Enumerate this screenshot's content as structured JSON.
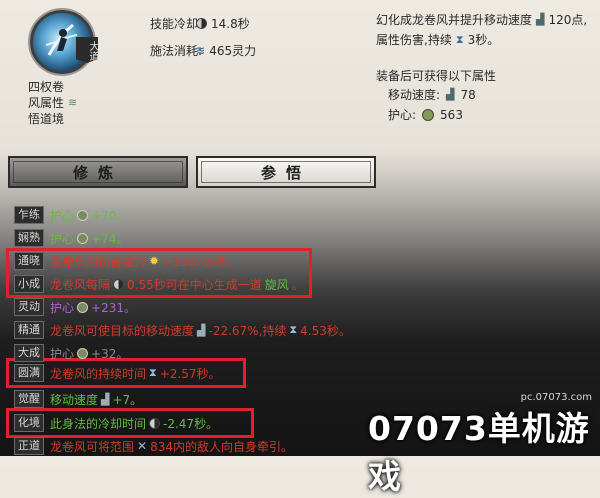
{
  "skill": {
    "badge": "大道",
    "meta": [
      "四权卷",
      "风属性",
      "悟道境"
    ],
    "cooldown_label": "技能冷却:",
    "cooldown_value": "14.8秒",
    "cost_label": "施法消耗:",
    "cost_value": "465灵力",
    "desc_line1": "幻化成龙卷风并提升移动速度",
    "desc_line1_value": "120点,",
    "desc_line2": "属性伤害,持续",
    "desc_line2_value": "3秒。",
    "equip_title": "装备后可获得以下属性",
    "equip_speed_label": "移动速度:",
    "equip_speed_value": "78",
    "equip_guard_label": "护心:",
    "equip_guard_value": "563"
  },
  "tabs": [
    {
      "label": "修炼",
      "active": false
    },
    {
      "label": "参悟",
      "active": true
    }
  ],
  "list": [
    {
      "tag": "乍练",
      "color": "#5fbf3c",
      "parts": [
        "护心",
        "+70。"
      ]
    },
    {
      "tag": "娴熟",
      "color": "#5fbf3c",
      "parts": [
        "护心",
        "+74。"
      ]
    },
    {
      "tag": "通晓",
      "color": "#d23a2a",
      "parts": [
        "龙卷风的伤害威力",
        "+15072/秒。"
      ]
    },
    {
      "tag": "小成",
      "color": "#d23a2a",
      "parts": [
        "龙卷风每隔",
        "0.55秒可在中心生成一道",
        "旋风",
        "。"
      ]
    },
    {
      "tag": "灵动",
      "color": "#b35fd6",
      "parts": [
        "护心",
        "+231。"
      ]
    },
    {
      "tag": "精通",
      "color": "#d23a2a",
      "parts": [
        "龙卷风可使目标的移动速度",
        "-22.67%,持续",
        "4.53秒。"
      ]
    },
    {
      "tag": "大成",
      "color": "#8a8a8a",
      "parts": [
        "护心",
        "+32。"
      ]
    },
    {
      "tag": "圆满",
      "color": "#d23a2a",
      "parts": [
        "龙卷风的持续时间",
        "+2.57秒。"
      ]
    },
    {
      "tag": "觉醒",
      "color": "#5fbf3c",
      "parts": [
        "移动速度",
        "+7。"
      ]
    },
    {
      "tag": "化境",
      "color": "#5fbf3c",
      "parts": [
        "此身法的冷却时间",
        "-2.47秒。"
      ]
    },
    {
      "tag": "正道",
      "color": "#d23a2a",
      "parts": [
        "龙卷风可将范围",
        "834内的敌人向自身牵引。"
      ]
    }
  ],
  "watermark": {
    "url": "pc.07073.com",
    "brand": "07073单机游戏"
  },
  "colors": {
    "highlight": "#e0202a"
  }
}
